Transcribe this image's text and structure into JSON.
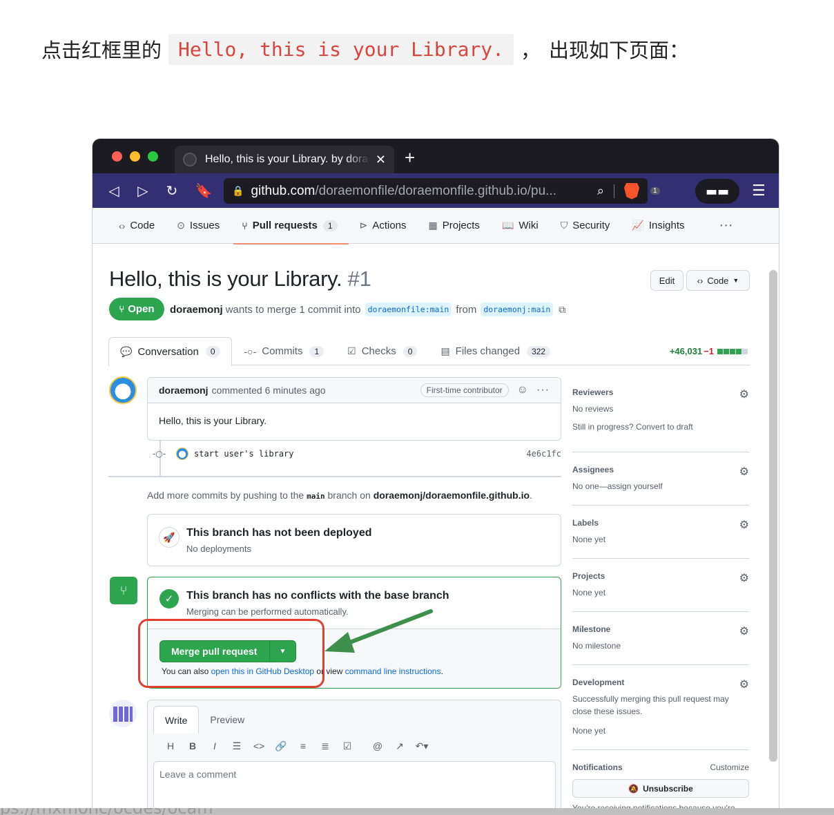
{
  "intro": {
    "prefix": "点击红框里的",
    "code": "Hello, this is your Library.",
    "comma": "，",
    "suffix": "出现如下页面："
  },
  "browser": {
    "tab_title": "Hello, this is your Library. by doraemonj",
    "new_tab": "+",
    "url_host": "github.com",
    "url_path": "/doraemonfile/doraemonfile.github.io/pu...",
    "shield_count": "1"
  },
  "repo_nav": {
    "items": [
      {
        "label": "Code",
        "icon": "code-icon"
      },
      {
        "label": "Issues",
        "icon": "issue-icon"
      },
      {
        "label": "Pull requests",
        "icon": "pull-request-icon",
        "count": "1",
        "active": true
      },
      {
        "label": "Actions",
        "icon": "play-icon"
      },
      {
        "label": "Projects",
        "icon": "table-icon"
      },
      {
        "label": "Wiki",
        "icon": "book-icon"
      },
      {
        "label": "Security",
        "icon": "shield-icon"
      },
      {
        "label": "Insights",
        "icon": "graph-icon"
      }
    ],
    "more": "···"
  },
  "pr": {
    "title": "Hello, this is your Library.",
    "number": "#1",
    "edit_label": "Edit",
    "code_label": "Code",
    "state": "Open",
    "author": "doraemonj",
    "meta_text": "wants to merge 1 commit into",
    "base_branch": "doraemonfile:main",
    "from_text": "from",
    "head_branch": "doraemonj:main"
  },
  "pr_tabs": [
    {
      "label": "Conversation",
      "count": "0",
      "icon": "comment-icon",
      "active": true
    },
    {
      "label": "Commits",
      "count": "1",
      "icon": "commit-icon"
    },
    {
      "label": "Checks",
      "count": "0",
      "icon": "checklist-icon"
    },
    {
      "label": "Files changed",
      "count": "322",
      "icon": "file-diff-icon"
    }
  ],
  "diffstat": {
    "additions": "+46,031",
    "deletions": "−1"
  },
  "comment": {
    "author": "doraemonj",
    "meta": "commented 6 minutes ago",
    "badge": "First-time contributor",
    "body": "Hello, this is your Library."
  },
  "commit": {
    "message": "start user's library",
    "sha": "4e6c1fc"
  },
  "push_hint": {
    "prefix": "Add more commits by pushing to the",
    "branch": "main",
    "middle": "branch on",
    "repo": "doraemonj/doraemonfile.github.io",
    "suffix": "."
  },
  "deploy": {
    "title": "This branch has not been deployed",
    "subtitle": "No deployments"
  },
  "merge": {
    "title": "This branch has no conflicts with the base branch",
    "subtitle": "Merging can be performed automatically.",
    "button": "Merge pull request",
    "hint_prefix": "You can also",
    "hint_link1": "open this in GitHub Desktop",
    "hint_middle": "or view",
    "hint_link2": "command line instructions",
    "hint_suffix": "."
  },
  "composer": {
    "tab_write": "Write",
    "tab_preview": "Preview",
    "placeholder": "Leave a comment",
    "toolbar": [
      "H",
      "B",
      "I",
      "☰",
      "<>",
      "🔗",
      "≡",
      "≣",
      "☑",
      "@",
      "↗",
      "↶▾"
    ]
  },
  "sidebar": {
    "reviewers": {
      "title": "Reviewers",
      "line1": "No reviews",
      "line2": "Still in progress? Convert to draft"
    },
    "assignees": {
      "title": "Assignees",
      "line1": "No one—assign yourself"
    },
    "labels": {
      "title": "Labels",
      "line1": "None yet"
    },
    "projects": {
      "title": "Projects",
      "line1": "None yet"
    },
    "milestone": {
      "title": "Milestone",
      "line1": "No milestone"
    },
    "development": {
      "title": "Development",
      "line1": "Successfully merging this pull request may close these issues.",
      "line2": "None yet"
    },
    "notifications": {
      "title": "Notifications",
      "customize": "Customize",
      "unsubscribe": "Unsubscribe",
      "line1": "You're receiving notifications because you're"
    }
  },
  "bottom_overlay": "ps://mxmonc/ocdes/ocam"
}
